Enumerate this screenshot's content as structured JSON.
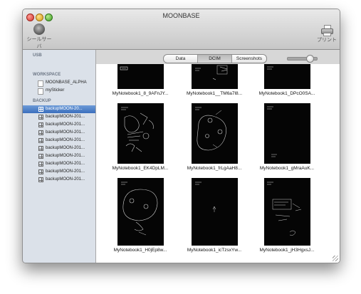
{
  "window": {
    "title": "MOONBASE"
  },
  "toolbar": {
    "serve_label": "シールサーバ",
    "print_label": "プリント"
  },
  "sidebar": {
    "usb_heading": "USB",
    "workspace_heading": "WORKSPACE",
    "workspace_items": [
      {
        "label": "MOONBASE_ALPHA",
        "icon": "document-icon"
      },
      {
        "label": "mySticker",
        "icon": "document-icon"
      }
    ],
    "backup_heading": "BACKUP",
    "backup_items": [
      {
        "label": "backupMOON-20...",
        "icon": "grid-icon",
        "selected": true
      },
      {
        "label": "backupMOON-201...",
        "icon": "grid-icon"
      },
      {
        "label": "backupMOON-201...",
        "icon": "grid-icon"
      },
      {
        "label": "backupMOON-201...",
        "icon": "grid-icon"
      },
      {
        "label": "backupMOON-201...",
        "icon": "grid-icon"
      },
      {
        "label": "backupMOON-201...",
        "icon": "grid-icon"
      },
      {
        "label": "backupMOON-201...",
        "icon": "grid-icon"
      },
      {
        "label": "backupMOON-201...",
        "icon": "grid-icon"
      },
      {
        "label": "backupMOON-201...",
        "icon": "grid-icon"
      },
      {
        "label": "backupMOON-201...",
        "icon": "grid-icon"
      }
    ]
  },
  "tabs": [
    {
      "label": "Data",
      "active": false
    },
    {
      "label": "DCIM",
      "active": true
    },
    {
      "label": "Screenshots",
      "active": false
    }
  ],
  "zoom": {
    "level": 0.8
  },
  "files": [
    {
      "name": "MyNotebook1_8_9AFnJY..."
    },
    {
      "name": "MyNotebook1__TM6a7l8..."
    },
    {
      "name": "MyNotebook1_DPcO0SA..."
    },
    {
      "name": "MyNotebook1_EK4DpLM..."
    },
    {
      "name": "MyNotebook1_frLgAaH8..."
    },
    {
      "name": "MyNotebook1_gMraAuK..."
    },
    {
      "name": "MyNotebook1_H0jEp8w..."
    },
    {
      "name": "MyNotebook1_icTzsxYw..."
    },
    {
      "name": "MyNotebook1_jH3HgxsJ..."
    }
  ],
  "colors": {
    "selection": "#3b6fbd",
    "sidebar_bg": "#dbe1e9",
    "thumb_bg": "#050505"
  }
}
